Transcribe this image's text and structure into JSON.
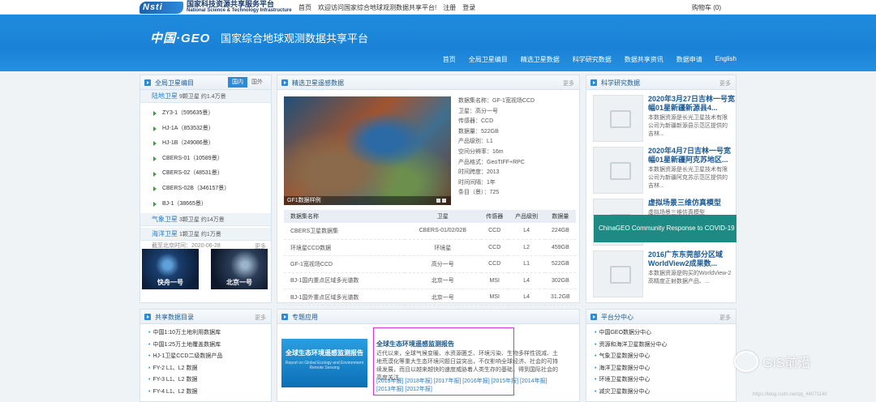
{
  "topbar": {
    "logo_mark": "Nsti",
    "logo_cn": "国家科技资源共享服务平台",
    "logo_en": "National Science & Technology Infrastructure",
    "links": [
      "首页",
      "欢迎访问国家综合地球观测数据共享平台!",
      "注册",
      "登录"
    ],
    "cart": "购物车 (0)"
  },
  "header": {
    "logo": "中国·GEO",
    "title": "国家综合地球观测数据共享平台",
    "nav": [
      "首页",
      "全局卫星编目",
      "精选卫星数据",
      "科学研究数据",
      "数据共享资讯",
      "数据申请",
      "English"
    ]
  },
  "catalog": {
    "title": "全局卫星编目",
    "tabs": [
      "国内",
      "国外"
    ],
    "land": {
      "name": "陆地卫星",
      "info": "9颗卫星 约1.4万景"
    },
    "satellites": [
      "ZY3-1（595635景）",
      "HJ-1A（853532景）",
      "HJ-1B（249086景）",
      "CBERS-01（10589景）",
      "CBERS-02（48531景）",
      "CBERS-02B（346157景）",
      "BJ-1（38665景）"
    ],
    "weather": {
      "name": "气象卫星",
      "info": "3颗卫星 约14万景"
    },
    "ocean": {
      "name": "海洋卫星",
      "info": "1颗卫星 约1万景"
    },
    "cutoff": "截至北京时间：2020-06-28",
    "more": "更多",
    "thumbs": [
      "快舟一号",
      "北京一号"
    ]
  },
  "selected": {
    "title": "精选卫星遥感数据",
    "more": "更多",
    "image_caption": "GF1数据样例",
    "meta": [
      "数据集名称：GF-1宽视场CCD",
      "卫星：高分一号",
      "传感器：CCD",
      "数据量：522GB",
      "产品级别：L1",
      "空间分辨率：16m",
      "产品格式：GeoTIFF+RPC",
      "时间跨度：2013",
      "时间间隔：1年",
      "条目（景）：725"
    ],
    "columns": [
      "数据集名称",
      "卫星",
      "传感器",
      "产品级别",
      "数据量"
    ],
    "rows": [
      [
        "CBERS卫星数据集",
        "CBERS-01/02/02B",
        "CCD",
        "L4",
        "224GB"
      ],
      [
        "环境星CCD数据",
        "环境星",
        "CCD",
        "L2",
        "459GB"
      ],
      [
        "GF-1宽视场CCD",
        "高分一号",
        "CCD",
        "L1",
        "522GB"
      ],
      [
        "BJ-1国内重点区域多光谱数",
        "北京一号",
        "MSI",
        "L4",
        "302GB"
      ],
      [
        "BJ-1国外重点区域多光谱数",
        "北京一号",
        "MSI",
        "L4",
        "31.2GB"
      ]
    ]
  },
  "research": {
    "title": "科学研究数据",
    "more": "更多",
    "items": [
      {
        "title": "2020年3月27日吉林一号宽幅01星新疆新源县4...",
        "desc": "本数据资源是长光卫星技术有限公司为新疆新源县示范区提供的吉林..."
      },
      {
        "title": "2020年4月7日吉林一号宽幅01星新疆阿克苏地区...",
        "desc": "本数据资源是长光卫星技术有限公司为新疆阿克苏示范区提供的吉林..."
      },
      {
        "title": "虚拟场景三维仿真模型",
        "desc": "虚拟场景三维仿真模型"
      },
      {
        "title": "2016广东东莞部分区域WorldView2成果数...",
        "desc": "本数据资源是购买的WorldView-2高精度正射数据产品、..."
      }
    ],
    "covid": "ChinaGEO Community Response to COVID-19"
  },
  "shared": {
    "title": "共享数据目录",
    "more": "更多",
    "items": [
      "中国1:10万土地利用数据库",
      "中国1:25万土地覆盖数据库",
      "HJ-1卫星CCD二级数据产品",
      "FY-2 L1、L2 数据",
      "FY-3 L1、L2 数据",
      "FY-4 L1、L2 数据"
    ]
  },
  "topic": {
    "title": "专题应用",
    "image_text": "全球生态环境遥感监测报告",
    "image_sub": "Report on Global Ecology and Environment Remote Sensing",
    "headline": "全球生态环境遥感监测报告",
    "text": "近代以来，全球气候变暖、水资源匮乏、环境污染、生物多样性锐减、土地荒漠化等重大生态环境问题日益突出，不仅影响全球经济、社会的可持续发展，而且以越来越快的速度威胁着人类生存的基础，得到国际社会的高度关注。",
    "years": "[2019年报] [2018年报] [2017年报] [2016年报] [2015年报] [2014年报] [2013年报] [2012年报]"
  },
  "platform": {
    "title": "平台分中心",
    "more": "更多",
    "items": [
      "中国GEO数据分中心",
      "资源和海洋卫星数据分中心",
      "气象卫星数据分中心",
      "海洋卫星数据分中心",
      "环境卫星数据分中心",
      "减灾卫星数据分中心"
    ]
  },
  "watermark": {
    "text": "GIS前沿",
    "url": "https://blog.csdn.net/qq_46071140"
  }
}
